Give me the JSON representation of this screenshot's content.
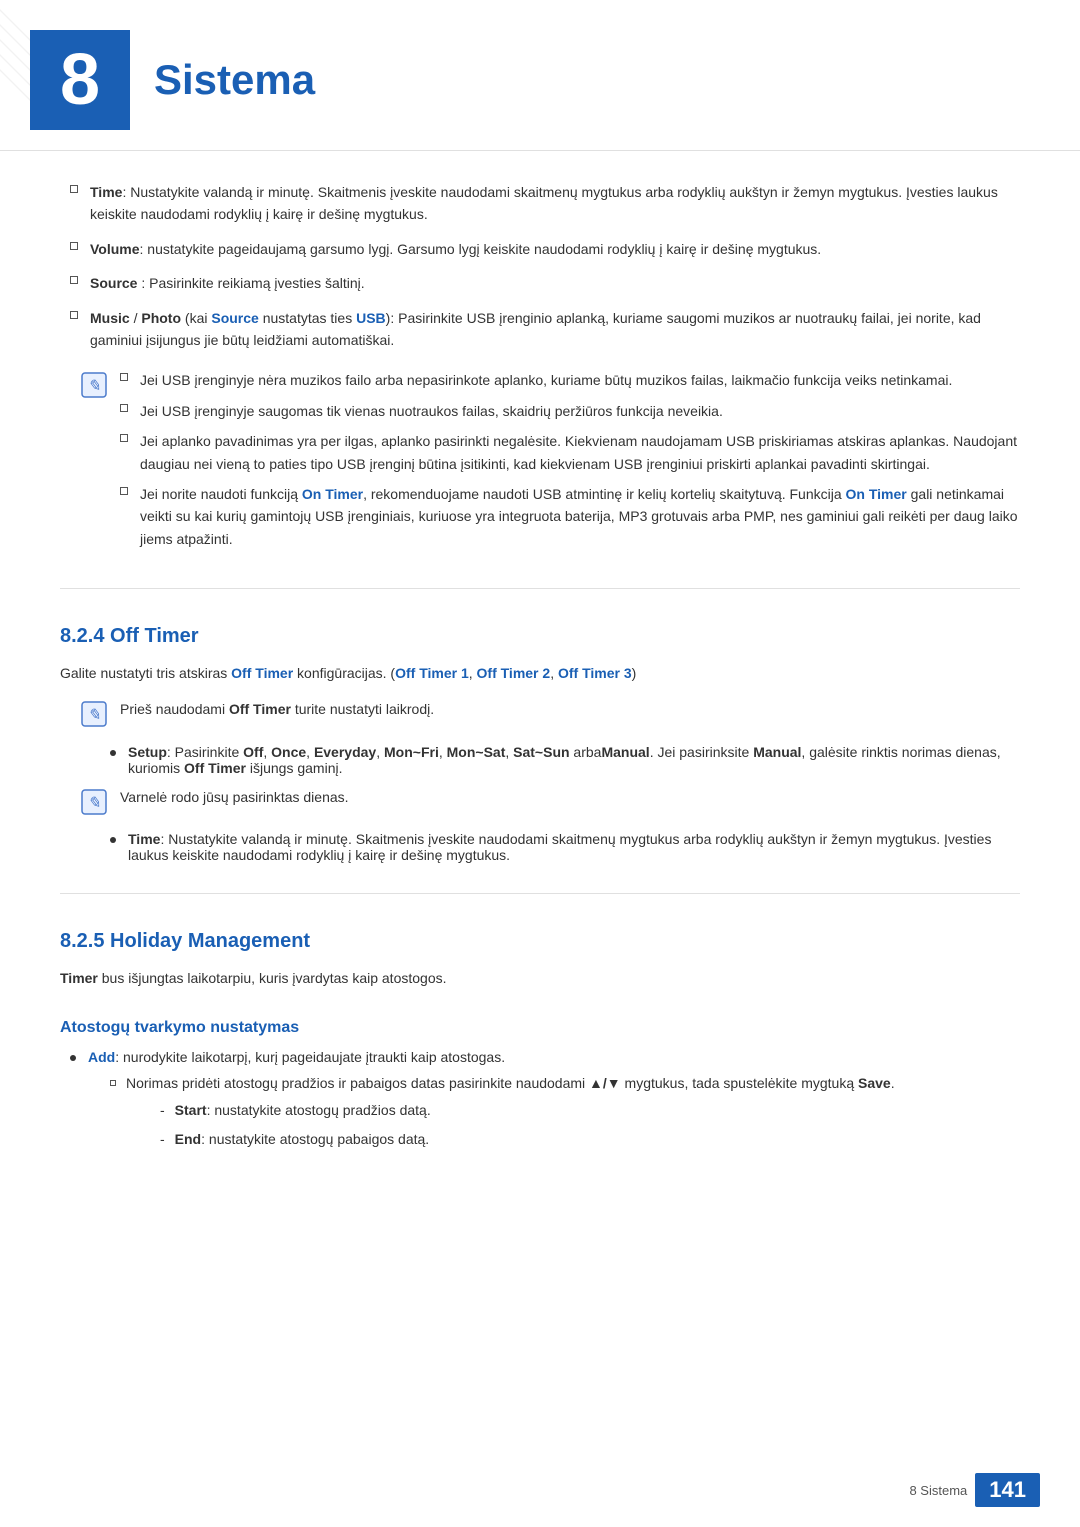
{
  "header": {
    "chapter_number": "8",
    "chapter_title": "Sistema"
  },
  "intro_bullets": [
    {
      "id": "time",
      "label": "Time",
      "text": ": Nustatykite valandą ir minutę. Skaitmenis įveskite naudodami skaitmenų mygtukus arba rodyklių aukštyn ir žemyn mygtukus. Įvesties laukus keiskite naudodami rodyklių į kairę ir dešinę mygtukus."
    },
    {
      "id": "volume",
      "label": "Volume",
      "text": ": nustatykite pageidaujamą garsumo lygį. Garsumo lygį keiskite naudodami rodyklių į kairę ir dešinę mygtukus."
    },
    {
      "id": "source",
      "label": "Source",
      "text": " : Pasirinkite reikiamą įvesties šaltinį."
    },
    {
      "id": "music_photo",
      "label_music": "Music",
      "label_slash": " / ",
      "label_photo": "Photo",
      "text_pre": " (kai ",
      "label_source": "Source",
      "text_mid": " nustatytas ties ",
      "label_usb": "USB",
      "text_post": "): Pasirinkite USB įrenginio aplanką, kuriame saugomi muzikos ar nuotraukų failai, jei norite, kad gaminiui įsijungus jie būtų leidžiami automatiškai."
    }
  ],
  "note1_items": [
    {
      "text": "Jei USB įrenginyje nėra muzikos failo arba nepasirinkote aplanko, kuriame būtų muzikos failas, laikmačio funkcija veiks netinkamai."
    },
    {
      "text": "Jei USB įrenginyje saugomas tik vienas nuotraukos failas, skaidrių peržiūros funkcija neveikia."
    },
    {
      "text": "Jei aplanko pavadinimas yra per ilgas, aplanko pasirinkti negalėsite. Kiekvienam naudojamam USB priskiriamas atskiras aplankas. Naudojant daugiau nei vieną to paties tipo USB įrenginį būtina įsitikinti, kad kiekvienam USB įrenginiui priskirti aplankai pavadinti skirtingai."
    },
    {
      "text_pre": "Jei norite naudoti funkciją ",
      "label1": "On Timer",
      "text_mid": ", rekomenduojame naudoti USB atmintinę ir kelių kortelių skaitytuvą. Funkcija ",
      "label2": "On Timer",
      "text_post": " gali netinkamai veikti su kai kurių gamintojų USB įrenginiais, kuriuose yra integruota baterija, MP3 grotuvais arba PMP, nes gaminiui gali reikėti per daug laiko jiems atpažinti."
    }
  ],
  "section_824": {
    "heading": "8.2.4   Off Timer",
    "para1_pre": "Galite nustatyti tris atskiras ",
    "para1_label": "Off Timer",
    "para1_mid": " konfigūracijas. (",
    "para1_label2": "Off Timer 1",
    "para1_comma1": ", ",
    "para1_label3": "Off Timer 2",
    "para1_comma2": ", ",
    "para1_label4": "Off Timer 3",
    "para1_end": ")",
    "note2_text_pre": "Prieš naudodami ",
    "note2_label": "Off Timer",
    "note2_text_post": " turite nustatyti laikrodį.",
    "setup_label": "Setup",
    "setup_text_pre": ": Pasirinkite ",
    "setup_off": "Off",
    "setup_comma1": ", ",
    "setup_once": "Once",
    "setup_comma2": ", ",
    "setup_everyday": "Everyday",
    "setup_comma3": ", ",
    "setup_monfri": "Mon~Fri",
    "setup_comma4": ", ",
    "setup_monsat": "Mon~Sat",
    "setup_comma5": ", ",
    "setup_satsun": "Sat~Sun",
    "setup_arba": " arba",
    "setup_manual": "Manual",
    "setup_text_post_pre": ". Jei pasirinksite ",
    "setup_manual2": "Manual",
    "setup_text_post": ", galėsite rinktis norimas dienas, kuriomis ",
    "setup_offtimer": "Off Timer",
    "setup_text_end": " išjungs gaminį.",
    "note3_text": "Varnelė rodo jūsų pasirinktas dienas.",
    "time_label": "Time",
    "time_text": ": Nustatykite valandą ir minutę. Skaitmenis įveskite naudodami skaitmenų mygtukus arba rodyklių aukštyn ir žemyn mygtukus. Įvesties laukus keiskite naudodami rodyklių į kairę ir dešinę mygtukus."
  },
  "section_825": {
    "heading": "8.2.5   Holiday Management",
    "para1_pre": "",
    "para1_label": "Timer",
    "para1_text": " bus išjungtas laikotarpiu, kuris įvardytas kaip atostogos.",
    "sub_heading": "Atostogų tvarkymo nustatymas",
    "add_label": "Add",
    "add_text": ": nurodykite laikotarpį, kurį pageidaujate įtraukti kaip atostogas.",
    "norimas_text_pre": "Norimas pridėti atostogų pradžios ir pabaigos datas pasirinkite naudodami ",
    "norimas_arrows": "▲/▼",
    "norimas_text_post": " mygtukus, tada spustelėkite mygtuką ",
    "norimas_save": "Save",
    "norimas_end": ".",
    "start_label": "Start",
    "start_text": ": nustatykite atostogų pradžios datą.",
    "end_label": "End",
    "end_text": ": nustatykite atostogų pabaigos datą."
  },
  "footer": {
    "text": "8 Sistema",
    "page": "141"
  }
}
